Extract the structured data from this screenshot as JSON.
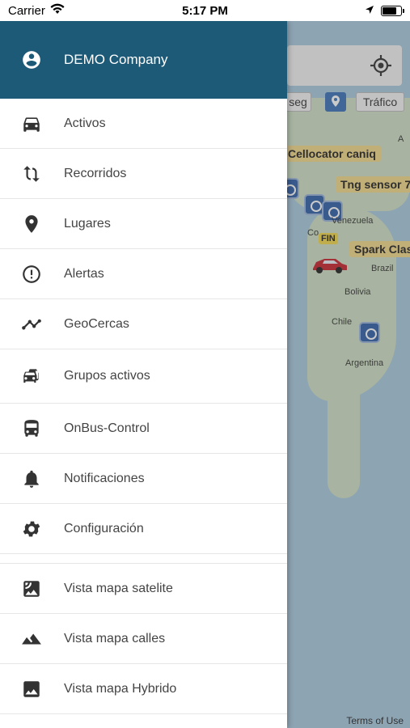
{
  "status": {
    "carrier": "Carrier",
    "time": "5:17 PM",
    "battery_level": 0.8
  },
  "drawer": {
    "company": "DEMO Company",
    "items": [
      {
        "label": "Activos",
        "icon": "car-icon"
      },
      {
        "label": "Recorridos",
        "icon": "route-icon"
      },
      {
        "label": "Lugares",
        "icon": "place-icon"
      },
      {
        "label": "Alertas",
        "icon": "alert-icon"
      },
      {
        "label": "GeoCercas",
        "icon": "timeline-icon"
      },
      {
        "label": "Grupos activos",
        "icon": "cars-group-icon"
      },
      {
        "label": "OnBus-Control",
        "icon": "bus-icon"
      },
      {
        "label": "Notificaciones",
        "icon": "bell-icon"
      },
      {
        "label": "Configuración",
        "icon": "gear-icon"
      }
    ],
    "map_items": [
      {
        "label": "Vista mapa satelite",
        "icon": "satellite-icon"
      },
      {
        "label": "Vista mapa calles",
        "icon": "terrain-icon"
      },
      {
        "label": "Vista mapa Hybrido",
        "icon": "image-icon"
      }
    ]
  },
  "map": {
    "buttons": {
      "seg": "seg",
      "traffic": "Tráfico"
    },
    "vehicle_labels": [
      "Cellocator caniq",
      "Tng sensor 7",
      "Spark Clas"
    ],
    "fin_label": "FIN",
    "geo_labels": [
      "Venezuela",
      "Co",
      "Brazil",
      "Bolivia",
      "Chile",
      "Argentina",
      "A"
    ],
    "terms": "Terms of Use"
  }
}
